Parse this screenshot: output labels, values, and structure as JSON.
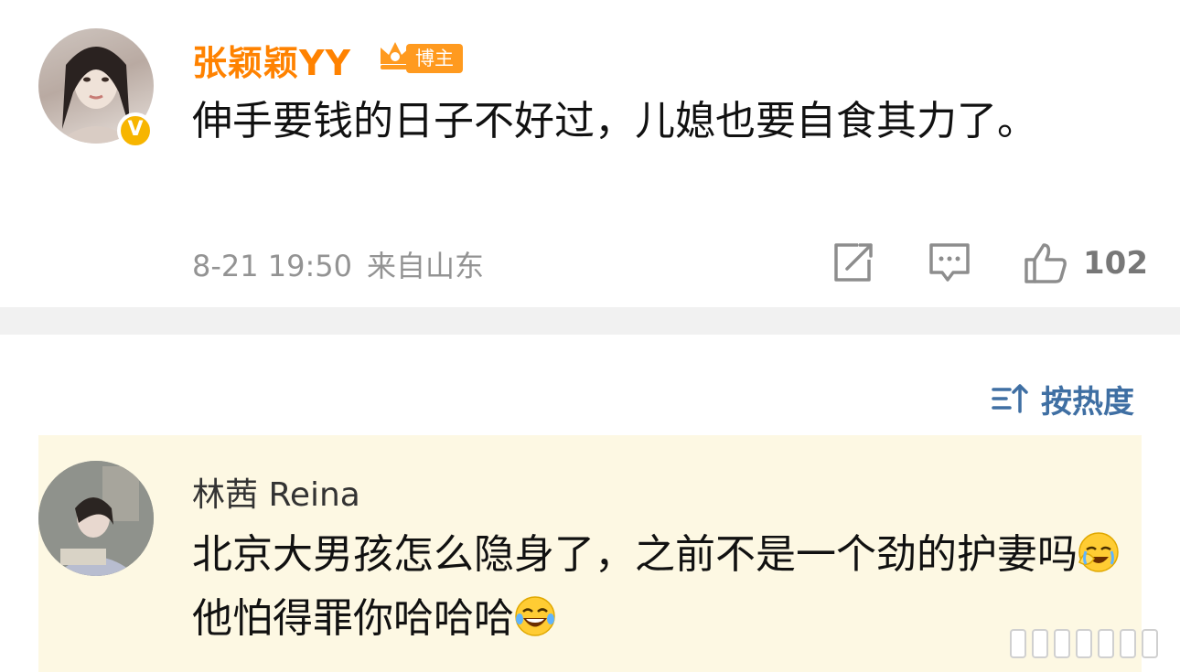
{
  "post": {
    "username": "张颖颖YY",
    "badge_label": "博主",
    "verified_mark": "V",
    "text": "伸手要钱的日子不好过，儿媳也要自食其力了。",
    "timestamp": "8-21 19:50",
    "location": "来自山东",
    "like_count": "102",
    "icons": [
      "share-icon",
      "comment-icon",
      "thumbs-up-icon"
    ]
  },
  "sort": {
    "label": "按热度",
    "icon": "sort-icon"
  },
  "comment": {
    "username": "林茜 Reina",
    "text_part1": "北京大男孩怎么隐身了，之前不是一个劲的护妻吗",
    "text_part2": "他怕得罪你哈哈哈",
    "emojis": [
      "facepalm-emoji",
      "laughing-tears-emoji"
    ]
  },
  "colors": {
    "username_orange": "#ff8200",
    "badge_orange": "#ff9a1f",
    "verified_yellow": "#f7b500",
    "sort_blue": "#3f6fa3",
    "comment_bg": "#fdf8e3",
    "divider": "#f1f1f1"
  }
}
